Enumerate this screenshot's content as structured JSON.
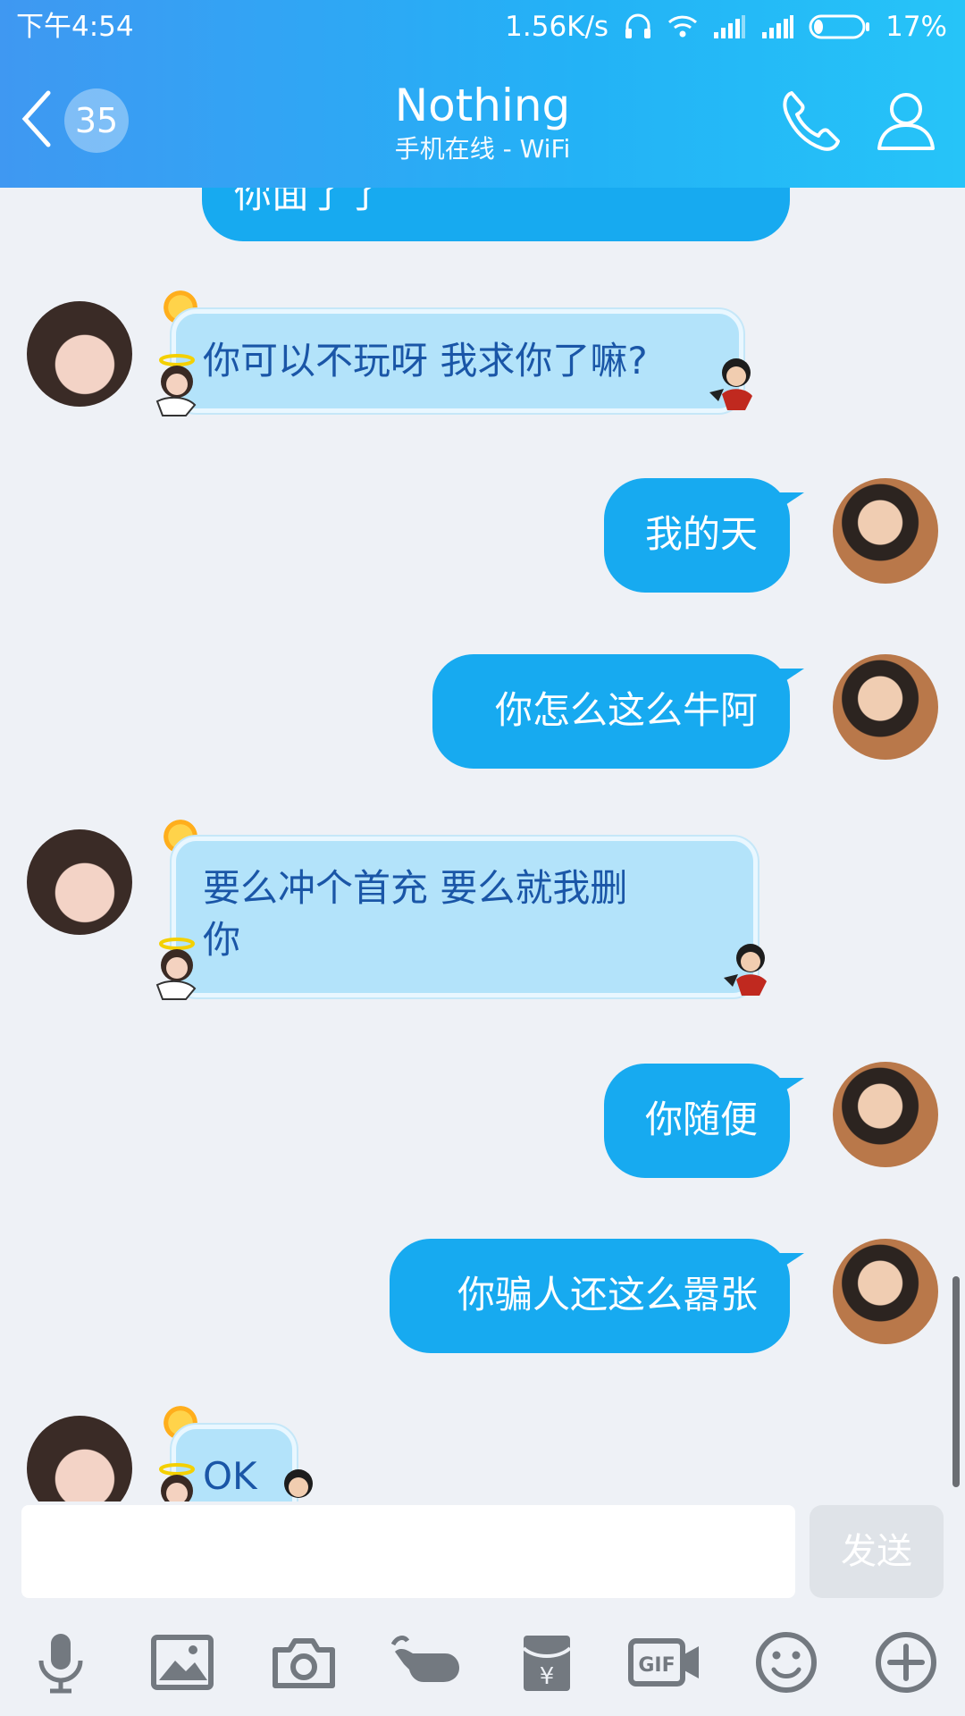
{
  "status_bar": {
    "time": "下午4:54",
    "net_speed": "1.56K/s",
    "battery": "17%",
    "icons": [
      "headset-icon",
      "wifi-icon",
      "signal-icon",
      "signal-icon",
      "battery-icon"
    ]
  },
  "header": {
    "back_icon": "chevron-left-icon",
    "unread_count": "35",
    "title": "Nothing",
    "subtitle": "手机在线 - WiFi",
    "call_icon": "phone-icon",
    "profile_icon": "person-icon"
  },
  "messages": [
    {
      "side": "out",
      "text": "你面了了"
    },
    {
      "side": "in",
      "text": "你可以不玩呀 我求你了嘛?"
    },
    {
      "side": "out",
      "text": "我的天"
    },
    {
      "side": "out",
      "text": "你怎么这么牛阿"
    },
    {
      "side": "in",
      "line1": "要么冲个首充   要么就我删",
      "line2": "你"
    },
    {
      "side": "out",
      "text": "你随便"
    },
    {
      "side": "out",
      "text": "你骗人还这么嚣张"
    },
    {
      "side": "in",
      "text": "OK"
    }
  ],
  "composer": {
    "input_value": "",
    "send_label": "发送"
  },
  "toolbar": {
    "items": [
      "microphone-icon",
      "image-icon",
      "camera-icon",
      "poke-icon",
      "red-packet-icon",
      "gif-icon",
      "emoji-icon",
      "plus-icon"
    ]
  },
  "colors": {
    "header_start": "#3f98f2",
    "header_end": "#26c4f8",
    "outgoing_bubble": "#17aaf0",
    "incoming_bubble": "#b3e3fa",
    "incoming_text": "#1a56a7",
    "background": "#eef1f6"
  }
}
